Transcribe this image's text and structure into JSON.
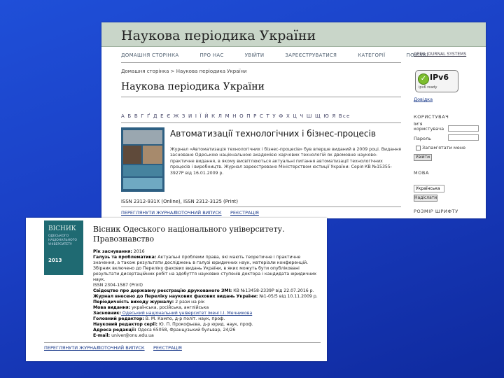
{
  "screen1": {
    "header_title": "Наукова періодика України",
    "nav": [
      "ДОМАШНЯ СТОРІНКА",
      "ПРО НАС",
      "УВІЙТИ",
      "ЗАРЕЄСТРУВАТИСЯ",
      "КАТЕГОРІЇ",
      "ПОШУК"
    ],
    "breadcrumb": "Домашня сторінка > Наукова періодика України",
    "page_title": "Наукова періодика України",
    "alphabet": "А Б В Г Ґ Д Е Є Ж З И І Ї Й К Л М Н О П Р С Т У Ф Х Ц Ч Ш Щ Ю Я Все",
    "journal": {
      "title": "Автоматизації технологічних і бізнес-процесів",
      "description": "Журнал «Автоматизація технологічних і бізнес-процесів» був вперше виданий в 2009 році. Видання засноване Одеською національною академією харчових технологій як двомовне науково-практичне видання, в якому висвітлюються актуальні питання автоматизації технологічних процесів і виробництв. Журнал зареєстровано Міністерством юстиції України: Серія КВ №15355-3927Р від 16.01.2009 р.",
      "issn": "ISSN 2312-931X (Online), ISSN 2312-3125 (Print)",
      "links": [
        "ПЕРЕГЛЯНУТИ ЖУРНАЛ",
        "ПОТОЧНИЙ ВИПУСК",
        "РЕЄСТРАЦІЯ"
      ]
    },
    "sidebar": {
      "ojs_label": "OPEN JOURNAL SYSTEMS",
      "ipv6_label": "IPv6",
      "ipv6_sub": "ipv6 ready",
      "help_link": "Довідка",
      "user_heading": "КОРИСТУВАЧ",
      "username_label": "Ім'я користувача",
      "password_label": "Пароль",
      "remember_label": "Запам'ятати мене",
      "login_button": "Увійти",
      "language_heading": "МОВА",
      "language_value": "Українська",
      "submit_button": "Надіслати",
      "font_size_heading": "РОЗМІР ШРИФТУ"
    }
  },
  "screen2": {
    "cover_title": "ВІСНИК",
    "cover_sub": "ОДЕСЬКОГО НАЦІОНАЛЬНОГО УНІВЕРСИТЕТУ",
    "cover_year": "2013",
    "title": "Вісник Одеського національного університету. Правознавство",
    "info": [
      {
        "label": "Рік заснування:",
        "value": " 2016"
      },
      {
        "label": "Галузь та проблематика:",
        "value": " Актуальні проблеми права, які мають теоретичне і практичне значення, а також результати досліджень в галузі юридичних наук, матеріали конференцій. Збірник включено до Переліку фахових видань України, в яких можуть бути опубліковані результати дисертаційних робіт на здобуття наукових ступенів доктора і кандидата юридичних наук."
      },
      {
        "label": "",
        "value": "ISSN 2304-1587 (Print)"
      },
      {
        "label": "Свідоцтво про державну реєстрацію друкованого ЗМІ:",
        "value": " КВ №13458-2339Р від 22.07.2016 р."
      },
      {
        "label": "Журнал внесено до Переліку наукових фахових видань України:",
        "value": " №1-05/5 від 10.11.2009 р."
      },
      {
        "label": "Періодичність виходу журналу:",
        "value": " 2 рази на рік"
      },
      {
        "label": "Мова видання:",
        "value": " українська, російська, англійська"
      },
      {
        "label": "Засновник:",
        "value": " Одеський національний університет імені І.І. Мечникова",
        "link": true
      },
      {
        "label": "Головний редактор:",
        "value": " В. М. Кампо, д-р політ. наук, проф."
      },
      {
        "label": "Науковий редактор серії:",
        "value": " Ю. П. Прокофьєва, д-р юрид. наук, проф."
      },
      {
        "label": "Адреса редакції:",
        "value": " Одеса 65058, Французький бульвар, 24/26"
      },
      {
        "label": "E-mail:",
        "value": " univer@onu.edu.ua"
      }
    ],
    "links": [
      "ПЕРЕГЛЯНУТИ ЖУРНАЛ",
      "ПОТОЧНИЙ ВИПУСК",
      "РЕЄСТРАЦІЯ"
    ]
  }
}
